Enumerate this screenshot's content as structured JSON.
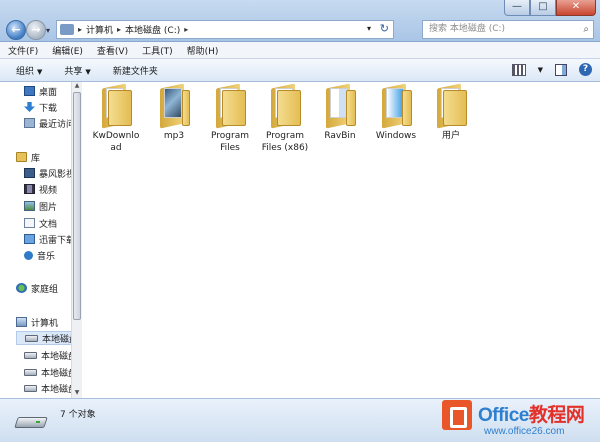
{
  "titlebar": {
    "minimize": "—",
    "maximize": "□",
    "close": "✕"
  },
  "navigation": {
    "back": "←",
    "forward": "→"
  },
  "address": {
    "crumbs": [
      "计算机",
      "本地磁盘 (C:)"
    ]
  },
  "search": {
    "placeholder": "搜索 本地磁盘 (C:)"
  },
  "menu": [
    "文件(F)",
    "编辑(E)",
    "查看(V)",
    "工具(T)",
    "帮助(H)"
  ],
  "commands": {
    "organize": "组织",
    "share": "共享",
    "new_folder": "新建文件夹"
  },
  "nav_pane": {
    "favorites": [
      "桌面",
      "下载",
      "最近访问"
    ],
    "library_title": "库",
    "libraries": [
      "暴风影视",
      "视频",
      "图片",
      "文档",
      "迅雷下载",
      "音乐"
    ],
    "homegroup": "家庭组",
    "computer_title": "计算机",
    "drives": [
      "本地磁盘",
      "本地磁盘",
      "本地磁盘",
      "本地磁盘"
    ]
  },
  "files": [
    {
      "name": "KwDownload",
      "label_l1": "KwDownlo",
      "label_l2": "ad",
      "icon": "folder-icon"
    },
    {
      "name": "mp3",
      "label_l1": "mp3",
      "label_l2": "",
      "icon": "folder-mp3-icon"
    },
    {
      "name": "Program Files",
      "label_l1": "Program",
      "label_l2": "Files",
      "icon": "folder-icon"
    },
    {
      "name": "Program Files (x86)",
      "label_l1": "Program",
      "label_l2": "Files (x86)",
      "icon": "folder-icon"
    },
    {
      "name": "RavBin",
      "label_l1": "RavBin",
      "label_l2": "",
      "icon": "folder-ravbin-icon"
    },
    {
      "name": "Windows",
      "label_l1": "Windows",
      "label_l2": "",
      "icon": "folder-windows-icon"
    },
    {
      "name": "用户",
      "label_l1": "用户",
      "label_l2": "",
      "icon": "folder-users-icon"
    }
  ],
  "status": {
    "count": "7 个对象"
  },
  "watermark": {
    "brand_a": "Office",
    "brand_b": "教程网",
    "url": "www.office26.com"
  },
  "colors": {
    "accent": "#2f7fcf",
    "folder": "#f1d27a",
    "selection": "#dbe8f8"
  }
}
